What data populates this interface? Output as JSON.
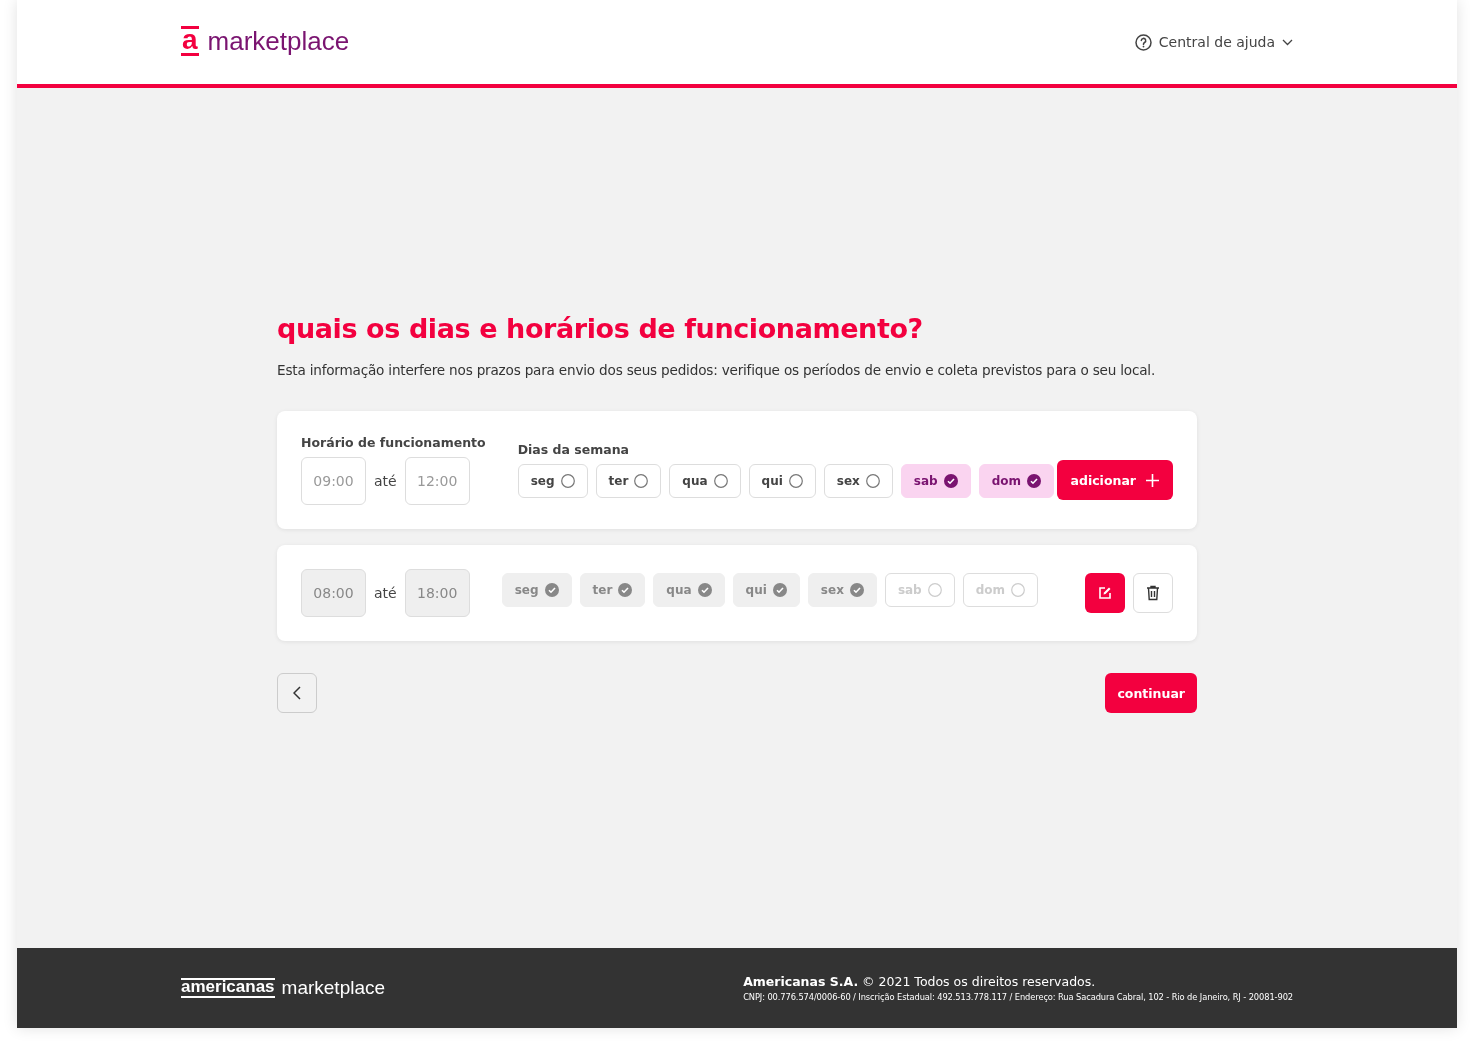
{
  "header": {
    "logo_mark": "a",
    "logo_text": "marketplace",
    "help": {
      "label": "Central de ajuda",
      "expanded": false
    }
  },
  "title": "quais os dias e horários de funcionamento?",
  "subtitle": "Esta informação interfere nos prazos para envio dos seus pedidos: verifique os períodos de envio e coleta previstos para o seu local.",
  "schedules": [
    {
      "kind": "editable",
      "hours_label": "Horário de funcionamento",
      "days_label": "Dias da semana",
      "start": "09:00",
      "separator": "até",
      "end": "12:00",
      "days": [
        {
          "label": "seg",
          "checked": false
        },
        {
          "label": "ter",
          "checked": false
        },
        {
          "label": "qua",
          "checked": false
        },
        {
          "label": "qui",
          "checked": false
        },
        {
          "label": "sex",
          "checked": false
        },
        {
          "label": "sab",
          "checked": true
        },
        {
          "label": "dom",
          "checked": true
        }
      ],
      "action": "adicionar"
    },
    {
      "kind": "saved",
      "start": "08:00",
      "separator": "até",
      "end": "18:00",
      "days": [
        {
          "label": "seg",
          "checked": true
        },
        {
          "label": "ter",
          "checked": true
        },
        {
          "label": "qua",
          "checked": true
        },
        {
          "label": "qui",
          "checked": true
        },
        {
          "label": "sex",
          "checked": true
        },
        {
          "label": "sab",
          "checked": false
        },
        {
          "label": "dom",
          "checked": false
        }
      ]
    }
  ],
  "continue_label": "continuar",
  "footer": {
    "brand": "americanas",
    "brand_suffix": "marketplace",
    "copyright": "**Americanas S.A.** © 2021 Todos os direitos reservados.",
    "legal": "CNPJ: 00.776.574/0006-60 / Inscrição Estadual: 492.513.778.117 / Endereço: Rua Sacadura Cabral, 102 - Rio de Janeiro, RJ - 20081-902"
  }
}
